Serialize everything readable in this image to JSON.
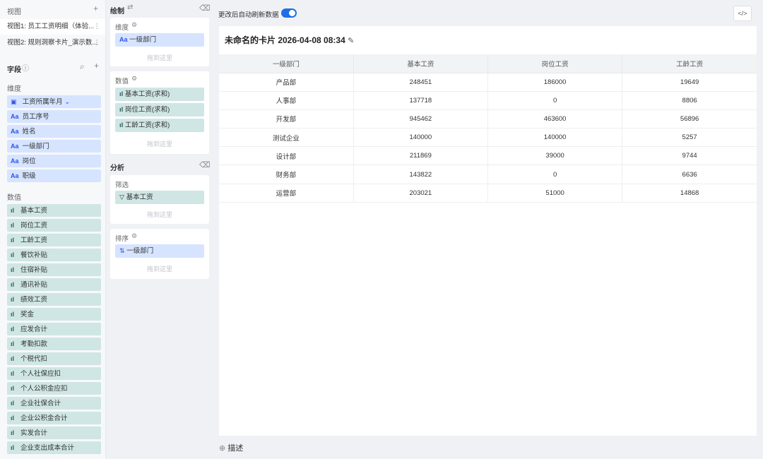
{
  "views": {
    "title": "视图",
    "items": [
      {
        "label": "视图1: 员工工资明细（体验..."
      },
      {
        "label": "视图2: 规则洞察卡片_演示数..."
      }
    ]
  },
  "fields": {
    "title": "字段",
    "dim_title": "维度",
    "dimensions": [
      {
        "label": "工资所属年月",
        "icon": "calendar-icon"
      },
      {
        "label": "员工序号",
        "icon": "text-type-icon"
      },
      {
        "label": "姓名",
        "icon": "text-type-icon"
      },
      {
        "label": "一级部门",
        "icon": "text-type-icon"
      },
      {
        "label": "岗位",
        "icon": "text-type-icon"
      },
      {
        "label": "职级",
        "icon": "text-type-icon"
      }
    ],
    "mea_title": "数值",
    "measures": [
      {
        "label": "基本工资"
      },
      {
        "label": "岗位工资"
      },
      {
        "label": "工龄工资"
      },
      {
        "label": "餐饮补贴"
      },
      {
        "label": "住宿补贴"
      },
      {
        "label": "通讯补贴"
      },
      {
        "label": "绩效工资"
      },
      {
        "label": "奖金"
      },
      {
        "label": "应发合计"
      },
      {
        "label": "考勤扣款"
      },
      {
        "label": "个税代扣"
      },
      {
        "label": "个人社保应扣"
      },
      {
        "label": "个人公积金应扣"
      },
      {
        "label": "企业社保合计"
      },
      {
        "label": "企业公积金合计"
      },
      {
        "label": "实发合计"
      },
      {
        "label": "企业支出成本合计"
      }
    ]
  },
  "draw": {
    "title": "绘制",
    "dim_title": "维度",
    "dim_items": [
      {
        "label": "一级部门"
      }
    ],
    "mea_title": "数值",
    "mea_items": [
      {
        "label": "基本工资(求和)"
      },
      {
        "label": "岗位工资(求和)"
      },
      {
        "label": "工龄工资(求和)"
      }
    ],
    "drop_hint": "拖到这里"
  },
  "analysis": {
    "title": "分析",
    "filter_title": "筛选",
    "filter_items": [
      {
        "label": "基本工资"
      }
    ],
    "sort_title": "排序",
    "sort_items": [
      {
        "label": "一级部门"
      }
    ]
  },
  "topbar": {
    "auto_refresh_label": "更改后自动刷新数据",
    "auto_refresh_on": true,
    "code_label": "</>"
  },
  "card": {
    "title": "未命名的卡片 2026-04-08 08:34",
    "columns": [
      "一级部门",
      "基本工资",
      "岗位工资",
      "工龄工资"
    ],
    "rows": [
      [
        "产品部",
        "248451",
        "186000",
        "19649"
      ],
      [
        "人事部",
        "137718",
        "0",
        "8806"
      ],
      [
        "开发部",
        "945462",
        "463600",
        "56896"
      ],
      [
        "测试企业",
        "140000",
        "140000",
        "5257"
      ],
      [
        "设计部",
        "211869",
        "39000",
        "9744"
      ],
      [
        "财务部",
        "143822",
        "0",
        "6636"
      ],
      [
        "运营部",
        "203021",
        "51000",
        "14868"
      ]
    ]
  },
  "describe": {
    "label": "描述"
  },
  "colors": {
    "accent": "#1f6fe5",
    "dim_chip": "#d6e4ff",
    "mea_chip": "#cfe6e4"
  }
}
